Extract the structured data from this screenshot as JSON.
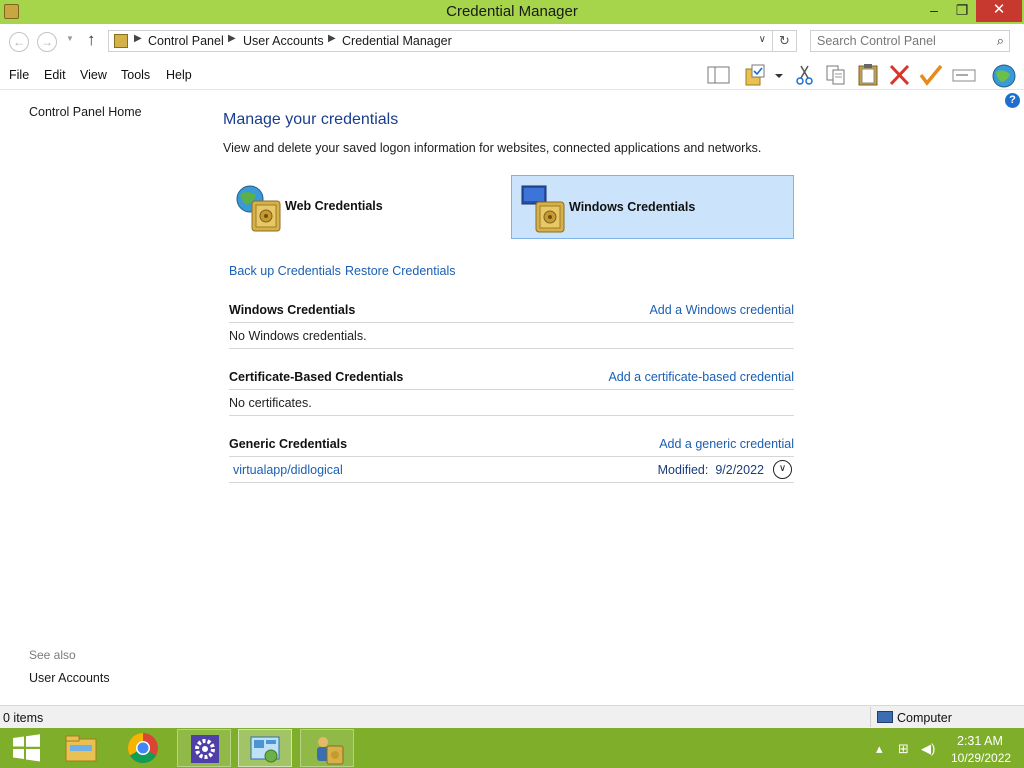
{
  "window": {
    "title": "Credential Manager",
    "minimize_glyph": "–",
    "restore_glyph": "❐",
    "close_glyph": "✕"
  },
  "address": {
    "crumbs": [
      "Control Panel",
      "User Accounts",
      "Credential Manager"
    ],
    "search_placeholder": "Search Control Panel"
  },
  "menu": [
    "File",
    "Edit",
    "View",
    "Tools",
    "Help"
  ],
  "toolbar_icons": [
    "layout-icon",
    "properties-icon",
    "cut-icon",
    "copy-icon",
    "paste-icon",
    "delete-icon",
    "check-icon",
    "rename-icon",
    "globe-icon"
  ],
  "left_pane": {
    "home": "Control Panel Home",
    "see_also": "See also",
    "user_accounts": "User Accounts"
  },
  "main": {
    "heading": "Manage your credentials",
    "subheading": "View and delete your saved logon information for websites, connected applications and networks.",
    "tiles": [
      {
        "label": "Web Credentials",
        "selected": false
      },
      {
        "label": "Windows Credentials",
        "selected": true
      }
    ],
    "backup": "Back up Credentials",
    "restore": "Restore Credentials",
    "sections": [
      {
        "title": "Windows Credentials",
        "add": "Add a Windows credential",
        "body": "No Windows credentials."
      },
      {
        "title": "Certificate-Based Credentials",
        "add": "Add a certificate-based credential",
        "body": "No certificates."
      },
      {
        "title": "Generic Credentials",
        "add": "Add a generic credential",
        "item": "virtualapp/didlogical",
        "modified_label": "Modified:",
        "modified_date": "9/2/2022"
      }
    ]
  },
  "status": {
    "items": "0 items",
    "location": "Computer"
  },
  "taskbar": {
    "apps": [
      "start",
      "file-explorer",
      "chrome",
      "settings",
      "control-panel",
      "credential-manager"
    ],
    "time": "2:31 AM",
    "date": "10/29/2022"
  },
  "colors": {
    "accent": "#a6d44a",
    "taskbar": "#7fae2b",
    "link": "#1a5fb4",
    "heading": "#1a3d8e",
    "selected_tile": "#cce4fb"
  }
}
